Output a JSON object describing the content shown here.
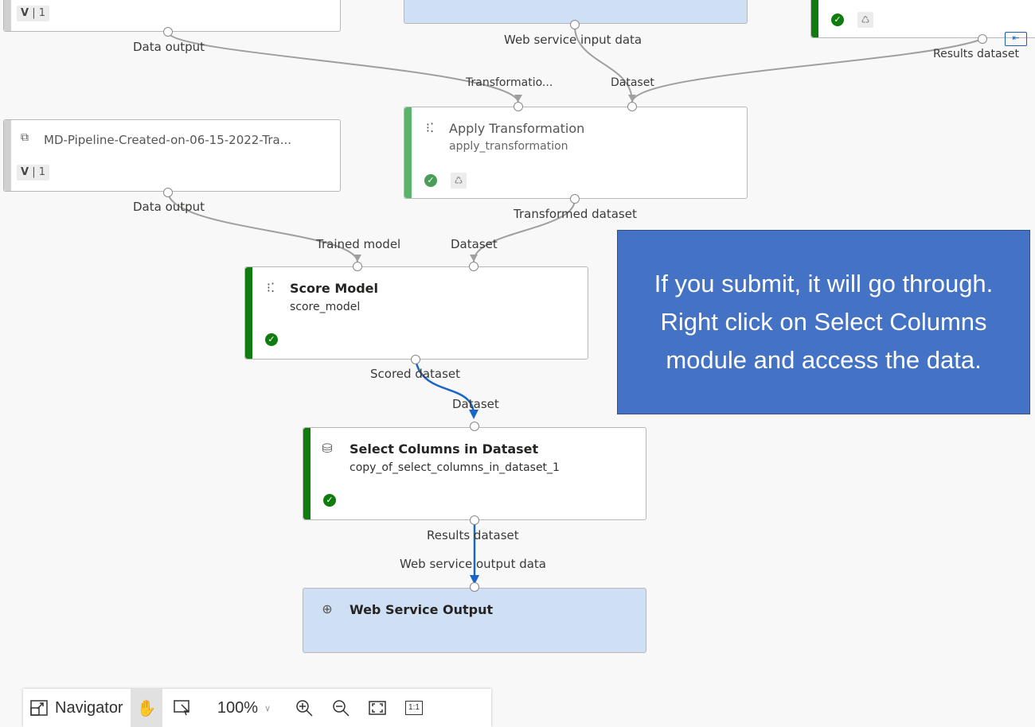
{
  "canvas": {
    "top_left_node": {
      "version_label": "V",
      "version_num": "1"
    },
    "top_right_node": {},
    "ports": {
      "data_output_1": "Data output",
      "web_service_input_data": "Web service input data",
      "results_dataset_top": "Results dataset",
      "transformation_in": "Transformatio...",
      "dataset_in_transform": "Dataset",
      "data_output_2": "Data output",
      "transformed_dataset": "Transformed dataset",
      "trained_model": "Trained model",
      "dataset_in_score": "Dataset",
      "scored_dataset": "Scored dataset",
      "dataset_in_select": "Dataset",
      "results_dataset": "Results dataset",
      "web_service_output_data": "Web service output data"
    },
    "pipeline_node": {
      "title": "MD-Pipeline-Created-on-06-15-2022-Tra...",
      "version_label": "V",
      "version_num": "1"
    },
    "apply_transformation": {
      "title": "Apply Transformation",
      "subtitle": "apply_transformation"
    },
    "score_model": {
      "title": "Score Model",
      "subtitle": "score_model"
    },
    "select_columns": {
      "title": "Select Columns in Dataset",
      "subtitle": "copy_of_select_columns_in_dataset_1"
    },
    "web_service_output": {
      "title": "Web Service Output"
    }
  },
  "callout": {
    "text": "If you submit, it will go through. Right click on Select Columns module and access the data."
  },
  "toolbar": {
    "navigator_label": "Navigator",
    "zoom_value": "100%",
    "actual_size_label": "1:1"
  },
  "colors": {
    "success_green": "#107c10",
    "callout_blue": "#4472c4",
    "selected_link_blue": "#1a66c6",
    "web_service_fill": "#cfe0f4"
  },
  "icons": {
    "status": "check-circle-icon",
    "reuse": "recycle-icon",
    "module": "scatter-chart-icon",
    "select_columns": "database-settings-icon",
    "web_service": "globe-icon",
    "pipeline": "pipeline-icon"
  }
}
